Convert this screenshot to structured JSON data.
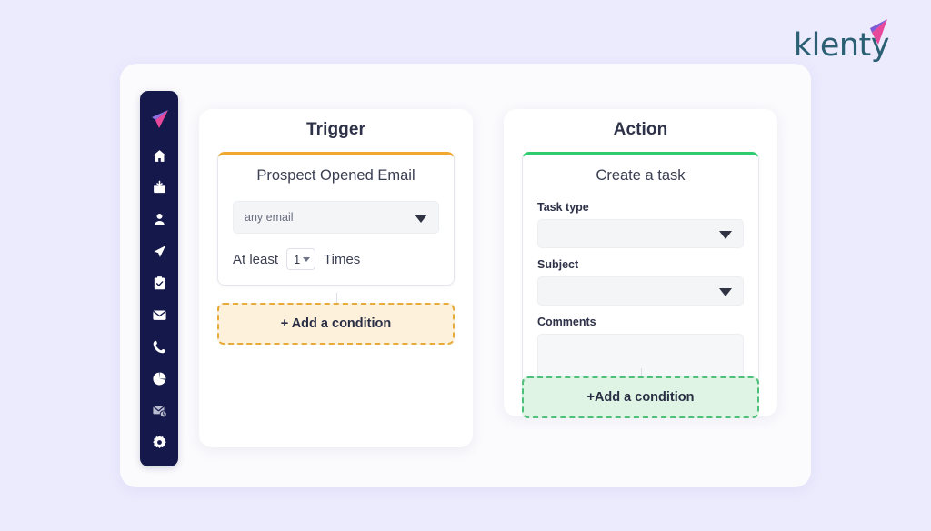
{
  "brand": {
    "name": "klenty",
    "logo_icon": "paper-plane-icon",
    "text_color": "#2b5f73",
    "accent_color": "#e8489b"
  },
  "sidebar": {
    "background": "#15184a",
    "logo_icon": "klenty-plane-logo-icon",
    "items": [
      {
        "icon": "home-icon",
        "name": "home"
      },
      {
        "icon": "inbox-download-icon",
        "name": "prospects-import"
      },
      {
        "icon": "user-icon",
        "name": "prospects"
      },
      {
        "icon": "paper-plane-icon",
        "name": "cadences"
      },
      {
        "icon": "clipboard-check-icon",
        "name": "tasks"
      },
      {
        "icon": "envelope-icon",
        "name": "inbox"
      },
      {
        "icon": "phone-icon",
        "name": "dialer"
      },
      {
        "icon": "pie-chart-icon",
        "name": "reports"
      },
      {
        "icon": "mail-clock-icon",
        "name": "scheduled-emails"
      },
      {
        "icon": "gear-icon",
        "name": "settings"
      }
    ]
  },
  "trigger": {
    "panel_title": "Trigger",
    "accent_color": "#f0a830",
    "node_title": "Prospect Opened Email",
    "email_select": {
      "value": "any email",
      "placeholder": "any email",
      "caret_icon": "chevron-down-icon"
    },
    "occurrence": {
      "prefix_label": "At least",
      "count_value": "1",
      "suffix_label": "Times",
      "caret_icon": "chevron-down-icon"
    },
    "add_condition_label": "+ Add a condition"
  },
  "action": {
    "panel_title": "Action",
    "accent_color": "#2ecb6f",
    "node_title": "Create a task",
    "fields": [
      {
        "label": "Task type",
        "type": "select",
        "value": "",
        "caret_icon": "chevron-down-icon"
      },
      {
        "label": "Subject",
        "type": "select",
        "value": "",
        "caret_icon": "chevron-down-icon"
      },
      {
        "label": "Comments",
        "type": "textarea",
        "value": ""
      }
    ],
    "add_condition_label": "+Add a condition"
  }
}
